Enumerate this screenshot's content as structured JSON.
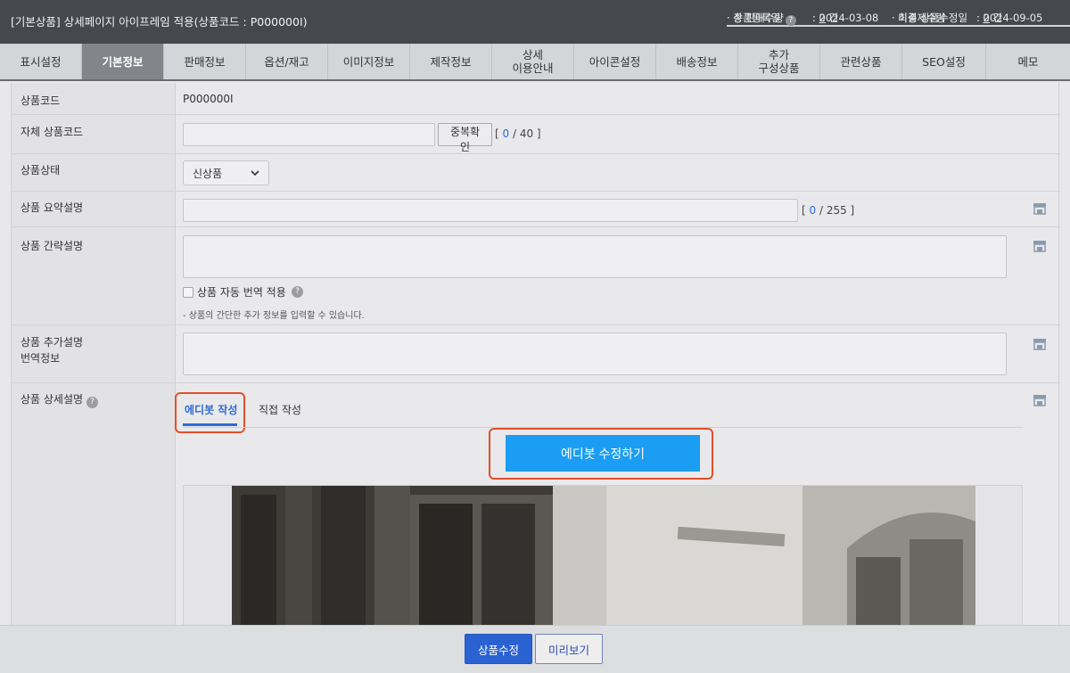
{
  "header": {
    "title": "[기본상품] 상세페이지 아이프레임 적용(상품코드 : P000000I)",
    "meta": {
      "reg_date_label": "· 상품등록일",
      "reg_date_value": ": 2024-03-08",
      "modified_label": "· 최종 상품수정일",
      "modified_value": ": 2024-09-05",
      "sold_label": "· 총 판매수량",
      "sold_value": "0",
      "sold_unit": " 건",
      "unsettled_label": "· 미결제수량",
      "unsettled_value": "0",
      "unsettled_unit": " 건",
      "colon": ": "
    }
  },
  "tabs": [
    {
      "label": "표시설정"
    },
    {
      "label": "기본정보",
      "active": true
    },
    {
      "label": "판매정보"
    },
    {
      "label": "옵션/재고"
    },
    {
      "label": "이미지정보"
    },
    {
      "label": "제작정보"
    },
    {
      "label": "상세\n이용안내"
    },
    {
      "label": "아이콘설정"
    },
    {
      "label": "배송정보"
    },
    {
      "label": "추가\n구성상품"
    },
    {
      "label": "관련상품"
    },
    {
      "label": "SEO설정"
    },
    {
      "label": "메모"
    }
  ],
  "form": {
    "product_code": {
      "label": "상품코드",
      "value": "P000000I"
    },
    "own_code": {
      "label": "자체 상품코드",
      "value": "",
      "dup_button": "중복확인",
      "counter_open": "[ ",
      "count": "0",
      "counter_rest": " / 40 ]"
    },
    "status": {
      "label": "상품상태",
      "selected": "신상품"
    },
    "summary": {
      "label": "상품 요약설명",
      "value": "",
      "counter_open": "[ ",
      "count": "0",
      "counter_rest": " / 255 ]"
    },
    "brief": {
      "label": "상품 간략설명",
      "auto_translate": "상품 자동 번역 적용",
      "note": "- 상품의 간단한 추가 정보를 입력할 수 있습니다."
    },
    "extra": {
      "label_line1": "상품 추가설명",
      "label_line2": "번역정보"
    },
    "detail": {
      "label": "상품 상세설명",
      "tab_editor": "에디봇 작성",
      "tab_direct": "직접 작성",
      "edit_button": "에디봇 수정하기"
    }
  },
  "footer": {
    "save": "상품수정",
    "preview": "미리보기"
  },
  "colors": {
    "accent": "#1a9df2",
    "primary": "#2a62d2",
    "highlight": "#e2502a",
    "active_tab_text": "#2f6bd8"
  }
}
